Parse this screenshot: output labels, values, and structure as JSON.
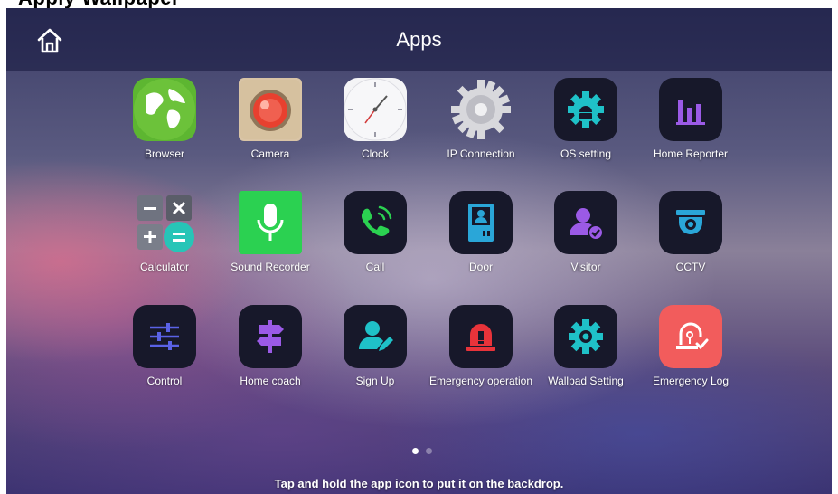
{
  "caption": "Apply Wallpaper",
  "header": {
    "title": "Apps",
    "home_icon": "home-icon"
  },
  "apps": [
    {
      "label": "Browser",
      "icon": "globe-icon"
    },
    {
      "label": "Camera",
      "icon": "camera-icon"
    },
    {
      "label": "Clock",
      "icon": "clock-icon"
    },
    {
      "label": "IP Connection",
      "icon": "gear-icon"
    },
    {
      "label": "OS setting",
      "icon": "android-gear-icon"
    },
    {
      "label": "Home Reporter",
      "icon": "bar-chart-icon"
    },
    {
      "label": "Calculator",
      "icon": "calculator-icon"
    },
    {
      "label": "Sound Recorder",
      "icon": "microphone-icon"
    },
    {
      "label": "Call",
      "icon": "phone-icon"
    },
    {
      "label": "Door",
      "icon": "door-icon"
    },
    {
      "label": "Visitor",
      "icon": "visitor-icon"
    },
    {
      "label": "CCTV",
      "icon": "cctv-icon"
    },
    {
      "label": "Control",
      "icon": "sliders-icon"
    },
    {
      "label": "Home coach",
      "icon": "signpost-icon"
    },
    {
      "label": "Sign Up",
      "icon": "user-edit-icon"
    },
    {
      "label": "Emergency operation",
      "icon": "siren-icon"
    },
    {
      "label": "Wallpad Setting",
      "icon": "settings-gear-icon"
    },
    {
      "label": "Emergency Log",
      "icon": "emergency-log-icon"
    }
  ],
  "pagination": {
    "current": 1,
    "total": 2
  },
  "hint": "Tap and hold the app icon to put it on the backdrop.",
  "colors": {
    "header_bg": "#14163c",
    "icon_dark": "#17182a",
    "teal": "#1fc1c8",
    "purple": "#8a52d8",
    "red": "#e8333a",
    "emergency_log_bg": "#f25c5c",
    "recorder_green": "#2bd151",
    "browser_green": "#5db631"
  }
}
